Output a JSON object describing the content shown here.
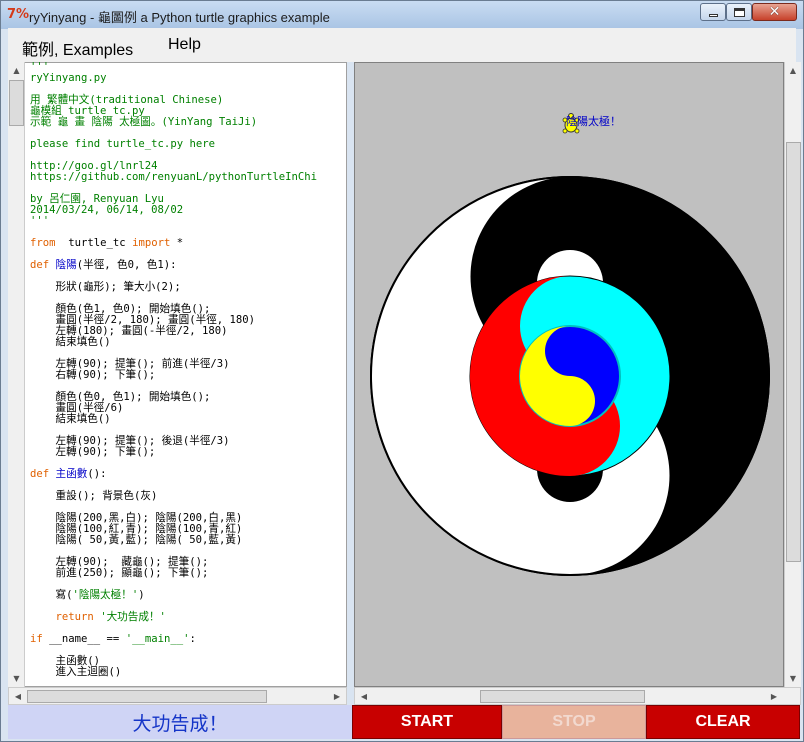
{
  "window": {
    "title": "ryYinyang - 龜圖例 a Python turtle graphics example",
    "app_icon_text": "7%",
    "controls": [
      "minimize",
      "maximize",
      "close"
    ]
  },
  "menubar": {
    "items": [
      {
        "label": "範例, Examples"
      },
      {
        "label": "Help"
      }
    ]
  },
  "code_lines": [
    {
      "t": "'''",
      "c": "c-green"
    },
    {
      "t": "ryYinyang.py",
      "c": "c-green"
    },
    {
      "t": "",
      "c": ""
    },
    {
      "t": "用 繁體中文(traditional Chinese)",
      "c": "c-green"
    },
    {
      "t": "龜模組 turtle_tc.py",
      "c": "c-green"
    },
    {
      "t": "示範 龜 畫 陰陽 太極圖。(YinYang TaiJi)",
      "c": "c-green"
    },
    {
      "t": "",
      "c": ""
    },
    {
      "t": "please find turtle_tc.py here",
      "c": "c-green"
    },
    {
      "t": "",
      "c": ""
    },
    {
      "t": "http://goo.gl/lnrl24",
      "c": "c-green"
    },
    {
      "t": "https://github.com/renyuanL/pythonTurtleInChi",
      "c": "c-green"
    },
    {
      "t": "",
      "c": ""
    },
    {
      "t": "by 呂仁園, Renyuan Lyu",
      "c": "c-green"
    },
    {
      "t": "2014/03/24, 06/14, 08/02",
      "c": "c-green"
    },
    {
      "t": "'''",
      "c": "c-green"
    },
    {
      "t": "",
      "c": ""
    },
    {
      "t": "from  turtle_tc import *",
      "c": "mix-from"
    },
    {
      "t": "",
      "c": ""
    },
    {
      "t": "def 陰陽(半徑, 色0, 色1):",
      "c": "mix-def1"
    },
    {
      "t": "",
      "c": ""
    },
    {
      "t": "    形狀(龜形); 筆大小(2);",
      "c": ""
    },
    {
      "t": "",
      "c": ""
    },
    {
      "t": "    顏色(色1, 色0); 開始填色();",
      "c": ""
    },
    {
      "t": "    畫圓(半徑/2, 180); 畫圓(半徑, 180)",
      "c": ""
    },
    {
      "t": "    左轉(180); 畫圓(-半徑/2, 180)",
      "c": ""
    },
    {
      "t": "    結束填色()",
      "c": ""
    },
    {
      "t": "",
      "c": ""
    },
    {
      "t": "    左轉(90); 提筆(); 前進(半徑/3)",
      "c": ""
    },
    {
      "t": "    右轉(90); 下筆();",
      "c": ""
    },
    {
      "t": "",
      "c": ""
    },
    {
      "t": "    顏色(色0, 色1); 開始填色();",
      "c": ""
    },
    {
      "t": "    畫圓(半徑/6)",
      "c": ""
    },
    {
      "t": "    結束填色()",
      "c": ""
    },
    {
      "t": "",
      "c": ""
    },
    {
      "t": "    左轉(90); 提筆(); 後退(半徑/3)",
      "c": ""
    },
    {
      "t": "    左轉(90); 下筆();",
      "c": ""
    },
    {
      "t": "",
      "c": ""
    },
    {
      "t": "def 主函數():",
      "c": "mix-def2"
    },
    {
      "t": "",
      "c": ""
    },
    {
      "t": "    重設(); 背景色(灰)",
      "c": ""
    },
    {
      "t": "",
      "c": ""
    },
    {
      "t": "    陰陽(200,黑,白); 陰陽(200,白,黑)",
      "c": ""
    },
    {
      "t": "    陰陽(100,紅,青); 陰陽(100,青,紅)",
      "c": ""
    },
    {
      "t": "    陰陽( 50,黃,藍); 陰陽( 50,藍,黃)",
      "c": ""
    },
    {
      "t": "",
      "c": ""
    },
    {
      "t": "    左轉(90);  藏龜(); 提筆();",
      "c": ""
    },
    {
      "t": "    前進(250); 顯龜(); 下筆();",
      "c": ""
    },
    {
      "t": "",
      "c": ""
    },
    {
      "t": "    寫('陰陽太極！')",
      "c": "mix-write"
    },
    {
      "t": "",
      "c": ""
    },
    {
      "t": "    return '大功告成！'",
      "c": "mix-return"
    },
    {
      "t": "",
      "c": ""
    },
    {
      "t": "if __name__ == '__main__':",
      "c": "mix-if"
    },
    {
      "t": "",
      "c": ""
    },
    {
      "t": "    主函數()",
      "c": ""
    },
    {
      "t": "    進入主迴圈()",
      "c": ""
    }
  ],
  "canvas": {
    "written_text": "陰陽太極！",
    "background_color": "#c0c0c0",
    "colors": {
      "black": "#000000",
      "white": "#ffffff",
      "red": "#ff0000",
      "cyan": "#00ffff",
      "yellow": "#ffff00",
      "blue": "#0000ff"
    }
  },
  "bottom": {
    "status_text": "大功告成！",
    "start_label": "START",
    "stop_label": "STOP",
    "clear_label": "CLEAR"
  }
}
